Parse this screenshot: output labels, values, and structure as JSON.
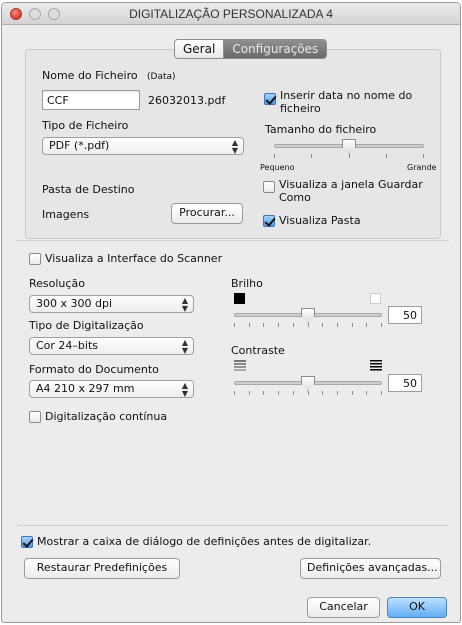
{
  "window": {
    "title": "DIGITALIZAÇÃO PERSONALIZADA 4"
  },
  "tabs": [
    {
      "label": "Geral",
      "selected": false
    },
    {
      "label": "Configurações",
      "selected": true
    }
  ],
  "file": {
    "name_label": "Nome do Ficheiro",
    "date_hint": "(Data)",
    "name_value": "CCF",
    "name_suffix": "26032013.pdf",
    "type_label": "Tipo de Ficheiro",
    "type_value": "PDF (*.pdf)",
    "insert_date_label": "Inserir data no nome do ficheiro",
    "insert_date_checked": true,
    "size_label": "Tamanho do ficheiro",
    "size_min_label": "Pequeno",
    "size_max_label": "Grande",
    "size_level": 0.5,
    "dest_label": "Pasta de Destino",
    "dest_value": "Imagens",
    "browse_label": "Procurar...",
    "show_save_label": "Visualiza a janela Guardar Como",
    "show_save_checked": false,
    "show_folder_label": "Visualiza Pasta",
    "show_folder_checked": true
  },
  "scanner": {
    "show_interface_label": "Visualiza a Interface do Scanner",
    "show_interface_checked": false,
    "resolution_label": "Resolução",
    "resolution_value": "300 x 300 dpi",
    "scan_type_label": "Tipo de Digitalização",
    "scan_type_value": "Cor 24–bits",
    "doc_format_label": "Formato do Documento",
    "doc_format_value": "A4 210 x 297 mm",
    "continuous_label": "Digitalização contínua",
    "continuous_checked": false,
    "brightness_label": "Brilho",
    "brightness_value": "50",
    "brightness_level": 0.5,
    "contrast_label": "Contraste",
    "contrast_value": "50",
    "contrast_level": 0.5
  },
  "footer": {
    "show_dialog_label": "Mostrar a caixa de diálogo de definições antes de digitalizar.",
    "show_dialog_checked": true,
    "restore_label": "Restaurar Predefinições",
    "advanced_label": "Definições avançadas...",
    "cancel_label": "Cancelar",
    "ok_label": "OK"
  },
  "colors": {
    "window_bg": "#ececec",
    "accent_blue": "#4e9ae8",
    "tab_selected": "#7a7a7a"
  }
}
